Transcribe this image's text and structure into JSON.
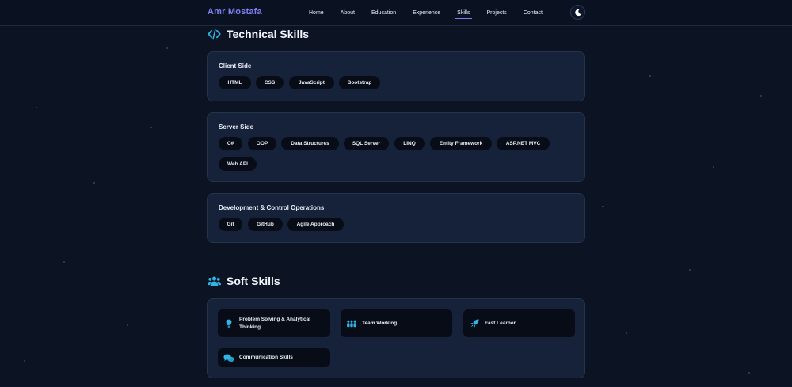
{
  "nav": {
    "brand": "Amr Mostafa",
    "links": [
      "Home",
      "About",
      "Education",
      "Experience",
      "Skills",
      "Projects",
      "Contact"
    ],
    "active": "Skills",
    "theme_icon": "moon-icon"
  },
  "technical": {
    "title": "Technical Skills",
    "icon": "code-icon",
    "groups": [
      {
        "title": "Client Side",
        "items": [
          "HTML",
          "CSS",
          "JavaScript",
          "Bootstrap"
        ]
      },
      {
        "title": "Server Side",
        "items": [
          "C#",
          "OOP",
          "Data Structures",
          "SQL Server",
          "LINQ",
          "Entity Framework",
          "ASP.NET MVC",
          "Web API"
        ]
      },
      {
        "title": "Development & Control Operations",
        "items": [
          "Git",
          "GitHub",
          "Agile Approach"
        ]
      }
    ]
  },
  "soft": {
    "title": "Soft Skills",
    "icon": "users-icon",
    "items": [
      {
        "label": "Problem Solving & Analytical Thinking",
        "icon": "lightbulb-icon"
      },
      {
        "label": "Team Working",
        "icon": "people-icon"
      },
      {
        "label": "Fast Learner",
        "icon": "rocket-icon"
      },
      {
        "label": "Communication Skills",
        "icon": "comments-icon"
      }
    ]
  },
  "colors": {
    "accent": "#7c7ff0",
    "icon": "#2fb5e6",
    "card": "#16223a",
    "chip": "#070c17"
  }
}
